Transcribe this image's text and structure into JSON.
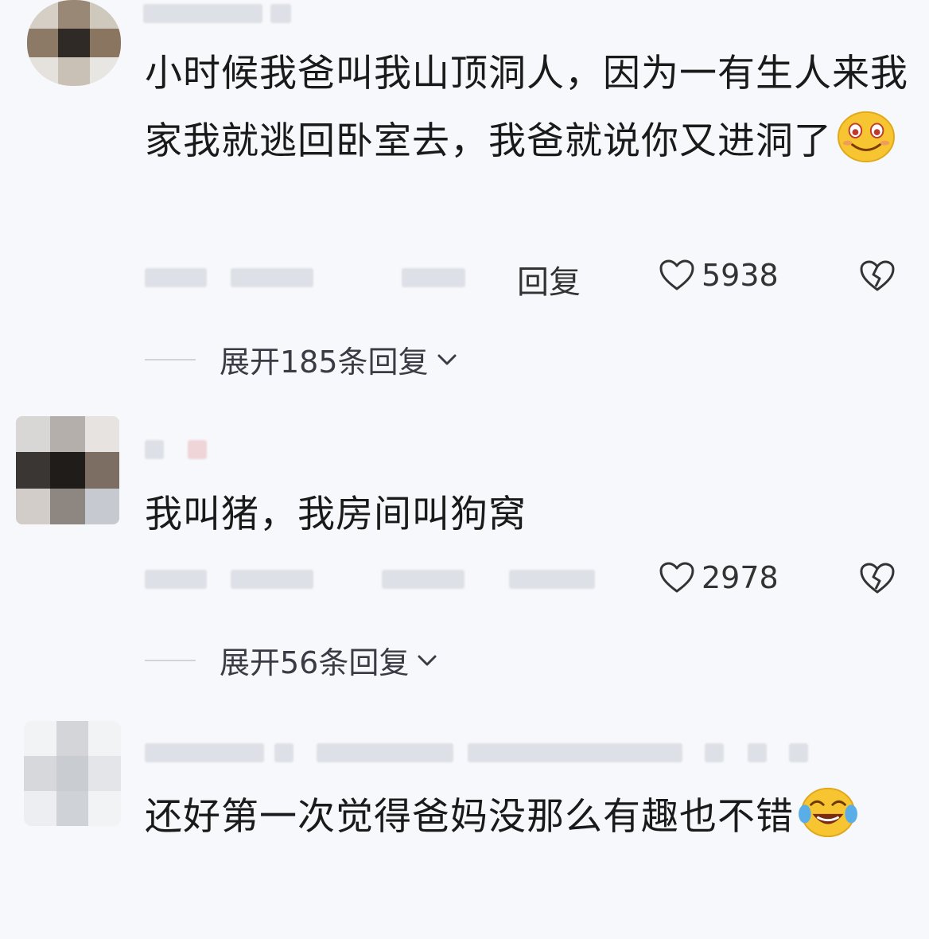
{
  "comments": [
    {
      "text": "小时候我爸叫我山顶洞人，因为一有生人来我家我就逃回卧室去，我爸就说你又进洞了",
      "emoji": "blush-smile-emoji",
      "reply_label": "回复",
      "likes": "5938",
      "expand_label": "展开185条回复"
    },
    {
      "text": "我叫猪，我房间叫狗窝",
      "likes": "2978",
      "expand_label": "展开56条回复"
    },
    {
      "text": "还好第一次觉得爸妈没那么有趣也不错",
      "emoji": "laugh-cry-emoji"
    }
  ],
  "icons": {
    "like": "heart-outline-icon",
    "dislike": "broken-heart-icon",
    "expand": "chevron-down-icon"
  },
  "colors": {
    "background": "#f7f8fb",
    "text": "#1a1a1a",
    "meta_text": "#333333",
    "emoji_yellow": "#f6c531"
  }
}
